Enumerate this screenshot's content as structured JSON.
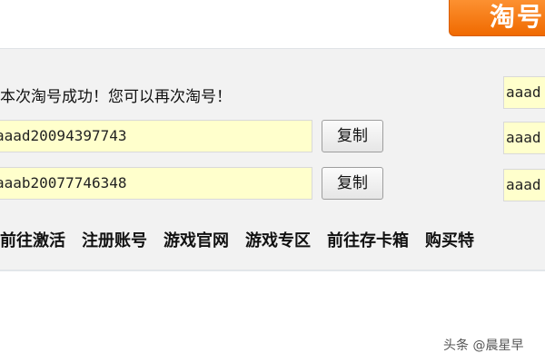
{
  "header": {
    "tao_button_label": "淘号"
  },
  "result": {
    "message": "本次淘号成功！您可以再次淘号！",
    "accounts": [
      {
        "value": "aaad20094397743",
        "copy_label": "复制"
      },
      {
        "value": "aaab20077746348",
        "copy_label": "复制"
      }
    ]
  },
  "side_fields": [
    "aaad",
    "aaad",
    "aaad"
  ],
  "links": [
    "前往激活",
    "注册账号",
    "游戏官网",
    "游戏专区",
    "前往存卡箱",
    "购买特"
  ],
  "watermark": "头条 @晨星早"
}
